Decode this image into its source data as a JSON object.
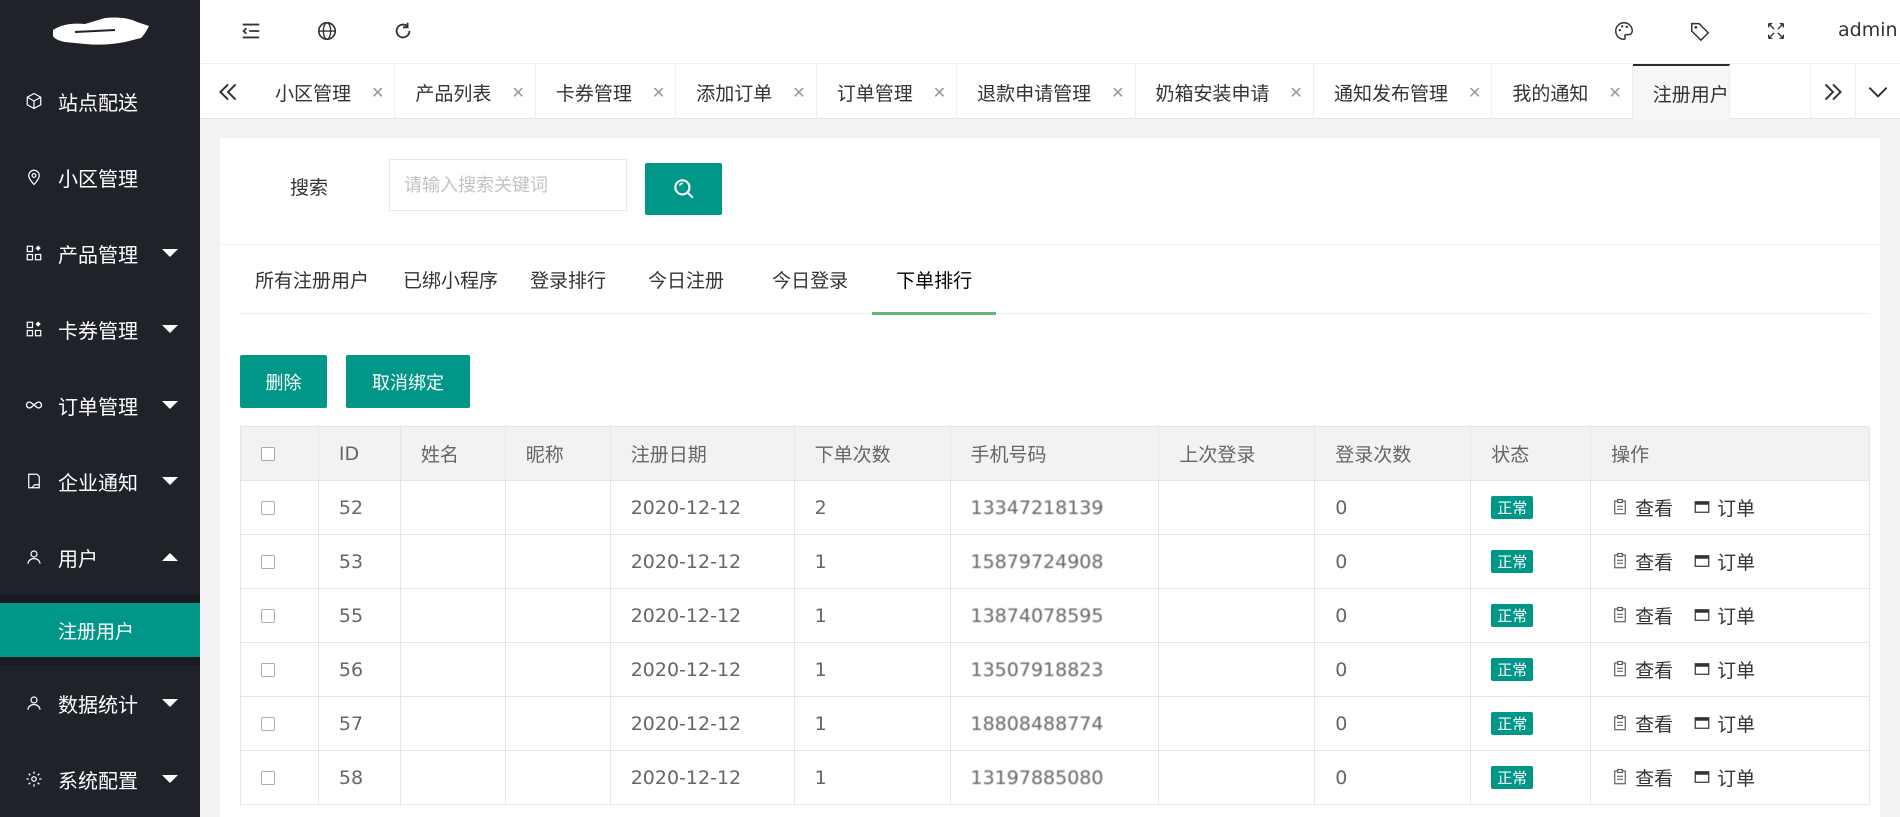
{
  "sidebar": {
    "items": [
      {
        "label": "站点配送",
        "icon": "cube-icon",
        "has_arrow": false
      },
      {
        "label": "小区管理",
        "icon": "location-icon",
        "has_arrow": false
      },
      {
        "label": "产品管理",
        "icon": "apps-icon",
        "has_arrow": true
      },
      {
        "label": "卡券管理",
        "icon": "apps-icon",
        "has_arrow": true
      },
      {
        "label": "订单管理",
        "icon": "infinity-icon",
        "has_arrow": true
      },
      {
        "label": "企业通知",
        "icon": "note-icon",
        "has_arrow": true
      },
      {
        "label": "用户",
        "icon": "user-icon",
        "has_arrow": true,
        "expanded": true
      },
      {
        "label": "数据统计",
        "icon": "user-icon",
        "has_arrow": true
      },
      {
        "label": "系统配置",
        "icon": "gear-icon",
        "has_arrow": true
      }
    ],
    "sub_item": "注册用户"
  },
  "header": {
    "user": "admin"
  },
  "tabs": [
    "小区管理",
    "产品列表",
    "卡券管理",
    "添加订单",
    "订单管理",
    "退款申请管理",
    "奶箱安装申请",
    "通知发布管理",
    "我的通知",
    "注册用户"
  ],
  "search": {
    "label": "搜索",
    "placeholder": "请输入搜索关键词"
  },
  "subtabs": [
    "所有注册用户",
    "已绑小程序",
    "登录排行",
    "今日注册",
    "今日登录",
    "下单排行"
  ],
  "actions": {
    "delete": "删除",
    "unbind": "取消绑定"
  },
  "table": {
    "headers": [
      "ID",
      "姓名",
      "昵称",
      "注册日期",
      "下单次数",
      "手机号码",
      "上次登录",
      "登录次数",
      "状态",
      "操作"
    ],
    "rows": [
      {
        "id": "52",
        "name": "",
        "nick": "",
        "date": "2020-12-12",
        "orders": "2",
        "phone": "13347218139",
        "last": "",
        "logins": "0",
        "status": "正常"
      },
      {
        "id": "53",
        "name": "",
        "nick": "",
        "date": "2020-12-12",
        "orders": "1",
        "phone": "15879724908",
        "last": "",
        "logins": "0",
        "status": "正常"
      },
      {
        "id": "55",
        "name": "",
        "nick": "",
        "date": "2020-12-12",
        "orders": "1",
        "phone": "13874078595",
        "last": "",
        "logins": "0",
        "status": "正常"
      },
      {
        "id": "56",
        "name": "",
        "nick": "",
        "date": "2020-12-12",
        "orders": "1",
        "phone": "13507918823",
        "last": "",
        "logins": "0",
        "status": "正常"
      },
      {
        "id": "57",
        "name": "",
        "nick": "",
        "date": "2020-12-12",
        "orders": "1",
        "phone": "18808488774",
        "last": "",
        "logins": "0",
        "status": "正常"
      },
      {
        "id": "58",
        "name": "",
        "nick": "",
        "date": "2020-12-12",
        "orders": "1",
        "phone": "13197885080",
        "last": "",
        "logins": "0",
        "status": "正常"
      }
    ],
    "op_view": "查看",
    "op_order": "订单"
  }
}
